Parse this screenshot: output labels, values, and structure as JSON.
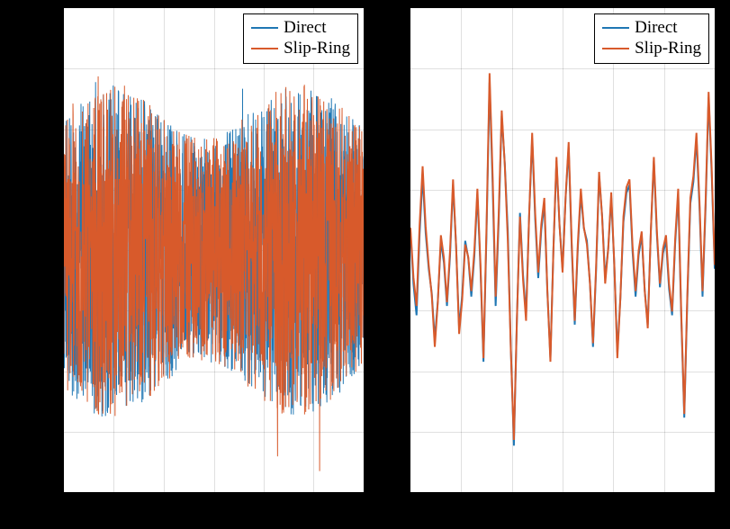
{
  "chart_data": [
    {
      "type": "line",
      "title": "",
      "xlabel": "",
      "ylabel": "",
      "xlim": [
        0,
        1
      ],
      "ylim": [
        -1.3,
        1.3
      ],
      "legend_position": "top-right",
      "grid": true,
      "description": "Dense high-frequency noise-like signal, two overlapping series (Direct vs Slip-Ring) nearly identical, amplitude roughly ±0.9 with occasional spikes to ±1.2",
      "series": [
        {
          "name": "Direct",
          "color": "#1f77b4",
          "approximate_envelope": {
            "upper": 0.9,
            "lower": -0.9,
            "spikes_to": 1.25
          }
        },
        {
          "name": "Slip-Ring",
          "color": "#d85a2b",
          "approximate_envelope": {
            "upper": 0.9,
            "lower": -0.9,
            "spikes_to": 1.25
          }
        }
      ]
    },
    {
      "type": "line",
      "title": "",
      "xlabel": "",
      "ylabel": "",
      "xlim": [
        0,
        1
      ],
      "ylim": [
        -1.3,
        1.3
      ],
      "legend_position": "top-right",
      "grid": true,
      "description": "Zoomed / lower-frequency view of the same two series; Direct and Slip-Ring track each other closely with visible oscillations",
      "series": [
        {
          "name": "Direct",
          "color": "#1f77b4",
          "x": [
            0.0,
            0.02,
            0.04,
            0.06,
            0.08,
            0.1,
            0.12,
            0.14,
            0.16,
            0.18,
            0.2,
            0.22,
            0.24,
            0.26,
            0.28,
            0.3,
            0.32,
            0.34,
            0.36,
            0.38,
            0.4,
            0.42,
            0.44,
            0.46,
            0.48,
            0.5,
            0.52,
            0.54,
            0.56,
            0.58,
            0.6,
            0.62,
            0.64,
            0.66,
            0.68,
            0.7,
            0.72,
            0.74,
            0.76,
            0.78,
            0.8,
            0.82,
            0.84,
            0.86,
            0.88,
            0.9,
            0.92,
            0.94,
            0.96,
            0.98,
            1.0
          ],
          "y": [
            0.1,
            -0.35,
            0.4,
            -0.1,
            -0.48,
            0.05,
            -0.3,
            0.35,
            -0.42,
            0.05,
            -0.25,
            0.3,
            -0.6,
            0.9,
            -0.3,
            0.72,
            0.1,
            -1.05,
            0.2,
            -0.35,
            0.6,
            -0.15,
            0.25,
            -0.58,
            0.48,
            -0.1,
            0.55,
            -0.4,
            0.3,
            0.05,
            -0.52,
            0.4,
            -0.15,
            0.28,
            -0.55,
            0.15,
            0.35,
            -0.25,
            0.08,
            -0.4,
            0.48,
            -0.2,
            0.05,
            -0.35,
            0.3,
            -0.9,
            0.25,
            0.6,
            -0.25,
            0.82,
            -0.1
          ]
        },
        {
          "name": "Slip-Ring",
          "color": "#d85a2b",
          "x": [
            0.0,
            0.02,
            0.04,
            0.06,
            0.08,
            0.1,
            0.12,
            0.14,
            0.16,
            0.18,
            0.2,
            0.22,
            0.24,
            0.26,
            0.28,
            0.3,
            0.32,
            0.34,
            0.36,
            0.38,
            0.4,
            0.42,
            0.44,
            0.46,
            0.48,
            0.5,
            0.52,
            0.54,
            0.56,
            0.58,
            0.6,
            0.62,
            0.64,
            0.66,
            0.68,
            0.7,
            0.72,
            0.74,
            0.76,
            0.78,
            0.8,
            0.82,
            0.84,
            0.86,
            0.88,
            0.9,
            0.92,
            0.94,
            0.96,
            0.98,
            1.0
          ],
          "y": [
            0.12,
            -0.3,
            0.45,
            -0.08,
            -0.52,
            0.08,
            -0.28,
            0.38,
            -0.45,
            0.03,
            -0.22,
            0.33,
            -0.58,
            0.95,
            -0.25,
            0.75,
            0.05,
            -1.02,
            0.18,
            -0.38,
            0.63,
            -0.12,
            0.28,
            -0.6,
            0.5,
            -0.12,
            0.58,
            -0.38,
            0.33,
            0.03,
            -0.5,
            0.42,
            -0.18,
            0.31,
            -0.58,
            0.18,
            0.38,
            -0.22,
            0.1,
            -0.42,
            0.5,
            -0.18,
            0.08,
            -0.33,
            0.33,
            -0.88,
            0.28,
            0.63,
            -0.22,
            0.85,
            -0.08
          ]
        }
      ]
    }
  ],
  "legend": {
    "direct": "Direct",
    "slip_ring": "Slip-Ring"
  }
}
